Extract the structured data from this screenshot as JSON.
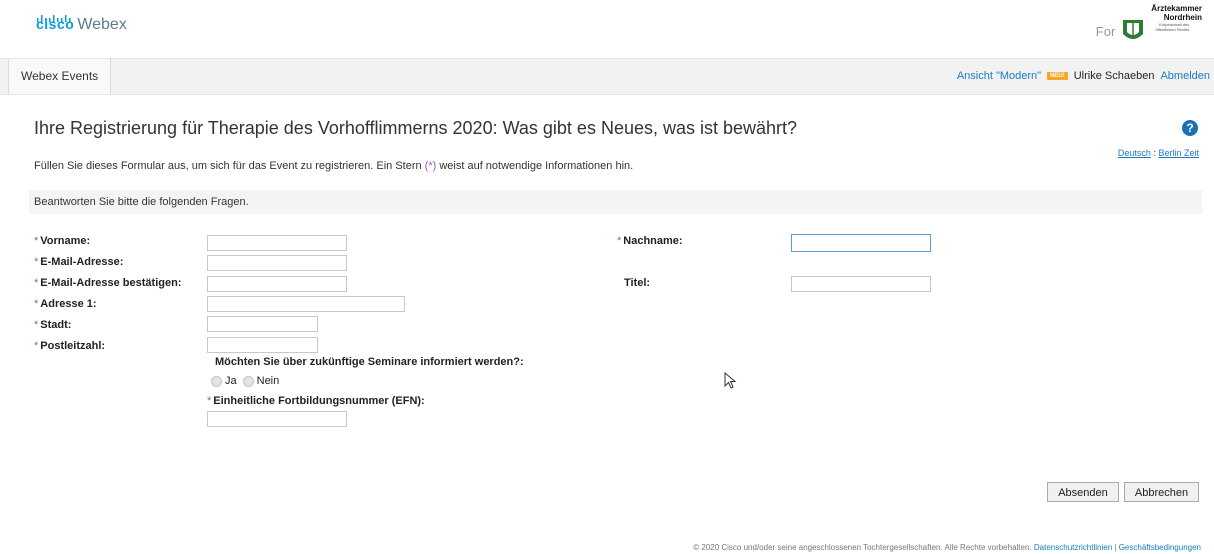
{
  "header": {
    "logo_cisco": "cisco",
    "logo_webex": "Webex",
    "for_label": "For",
    "org_name_line1": "Ärztekammer",
    "org_name_line2": "Nordrhein",
    "org_subtitle": "Körperschaft des öffentlichen Rechts"
  },
  "nav": {
    "tab": "Webex Events",
    "modern_view": "Ansicht \"Modern\"",
    "badge": "NEU!",
    "user": "Ulrike Schaeben",
    "logout": "Abmelden"
  },
  "page": {
    "title": "Ihre Registrierung für Therapie des Vorhofflimmerns 2020: Was gibt es Neues, was ist bewährt?",
    "language": "Deutsch",
    "separator": ":",
    "timezone": "Berlin Zeit",
    "instructions_pre": "Füllen Sie dieses Formular aus, um sich für das Event zu registrieren. Ein Stern ",
    "instructions_star": "(*)",
    "instructions_post": " weist auf notwendige Informationen hin.",
    "section_header": "Beantworten Sie bitte die folgenden Fragen."
  },
  "form": {
    "star": "*",
    "firstname_label": "Vorname:",
    "lastname_label": "Nachname:",
    "email_label": "E-Mail-Adresse:",
    "email_confirm_label": "E-Mail-Adresse bestätigen:",
    "title_label": "Titel:",
    "address_label": "Adresse 1:",
    "city_label": "Stadt:",
    "zip_label": "Postleitzahl:",
    "seminar_question": "Möchten Sie über zukünftige Seminare informiert werden?:",
    "yes": "Ja",
    "no": "Nein",
    "efn_label": "Einheitliche Fortbildungsnummer (EFN):",
    "values": {
      "firstname": "",
      "lastname": "",
      "email": "",
      "email_confirm": "",
      "title": "",
      "address": "",
      "city": "",
      "zip": "",
      "efn": ""
    }
  },
  "buttons": {
    "submit": "Absenden",
    "cancel": "Abbrechen"
  },
  "footer": {
    "copyright": "© 2020 Cisco und/oder seine angeschlossenen Tochtergesellschaften. Alle Rechte vorbehalten.",
    "privacy": "Datenschutzrichtlinien",
    "divider": "|",
    "terms": "Geschäftsbedingungen"
  },
  "colors": {
    "accent": "#1a7bc4",
    "required_star": "#9b59b6",
    "badge": "#f5a623",
    "cisco_blue": "#049fd9"
  },
  "icons": [
    "cisco-logo-bars-icon",
    "aekno-logo-icon",
    "help-icon",
    "mouse-cursor-icon"
  ]
}
